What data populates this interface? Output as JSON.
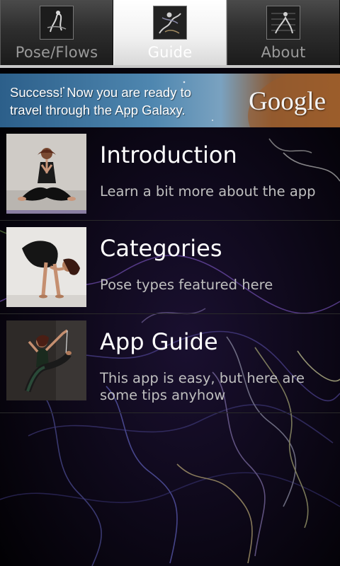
{
  "tabs": [
    {
      "label": "Pose/Flows",
      "icon": "pose-flows-icon",
      "selected": false
    },
    {
      "label": "Guide",
      "icon": "guide-icon",
      "selected": true
    },
    {
      "label": "About",
      "icon": "about-icon",
      "selected": false
    }
  ],
  "ad": {
    "text": "Success! Now you are ready to travel through the App Galaxy.",
    "logo": "Google"
  },
  "list": {
    "items": [
      {
        "title": "Introduction",
        "subtitle": "Learn a bit more about the app",
        "image": "meditation-pose-photo"
      },
      {
        "title": "Categories",
        "subtitle": "Pose types featured here",
        "image": "crow-pose-photo"
      },
      {
        "title": "App Guide",
        "subtitle": "This app is easy, but here are some tips anyhow",
        "image": "dancer-pose-photo"
      }
    ]
  },
  "colors": {
    "background": "#050208",
    "tab_selected": "#f2f2f2",
    "tab_unselected": "#2e2e2e",
    "title_text": "#ffffff",
    "subtitle_text": "#bfbfbf"
  }
}
